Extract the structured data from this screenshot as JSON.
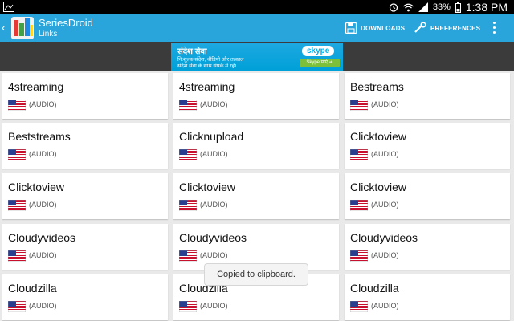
{
  "status_bar": {
    "battery_pct": "33%",
    "time": "1:38 PM",
    "icons": [
      "image-icon",
      "alarm-icon",
      "wifi-icon",
      "signal-icon",
      "battery-icon"
    ]
  },
  "action_bar": {
    "app_title": "SeriesDroid",
    "subtitle": "Links",
    "downloads_label": "DOWNLOADS",
    "preferences_label": "PREFERENCES",
    "color": "#29a5dc"
  },
  "ad": {
    "headline": "संदेश सेवा",
    "line1": "नि:शुल्क संदेश, वीडियो और तत्काल",
    "line2": "संदेश सेवा के साथ संपर्क में रहें।",
    "brand": "skype",
    "cta": "Skype पाएं"
  },
  "links": [
    {
      "name": "4streaming",
      "tag": "(AUDIO)"
    },
    {
      "name": "4streaming",
      "tag": "(AUDIO)"
    },
    {
      "name": "Bestreams",
      "tag": "(AUDIO)"
    },
    {
      "name": "Beststreams",
      "tag": "(AUDIO)"
    },
    {
      "name": "Clicknupload",
      "tag": "(AUDIO)"
    },
    {
      "name": "Clicktoview",
      "tag": "(AUDIO)"
    },
    {
      "name": "Clicktoview",
      "tag": "(AUDIO)"
    },
    {
      "name": "Clicktoview",
      "tag": "(AUDIO)"
    },
    {
      "name": "Clicktoview",
      "tag": "(AUDIO)"
    },
    {
      "name": "Cloudyvideos",
      "tag": "(AUDIO)"
    },
    {
      "name": "Cloudyvideos",
      "tag": "(AUDIO)"
    },
    {
      "name": "Cloudyvideos",
      "tag": "(AUDIO)"
    },
    {
      "name": "Cloudzilla",
      "tag": "(AUDIO)"
    },
    {
      "name": "Cloudzilla",
      "tag": "(AUDIO)"
    },
    {
      "name": "Cloudzilla",
      "tag": "(AUDIO)"
    }
  ],
  "toast": {
    "message": "Copied to clipboard."
  }
}
